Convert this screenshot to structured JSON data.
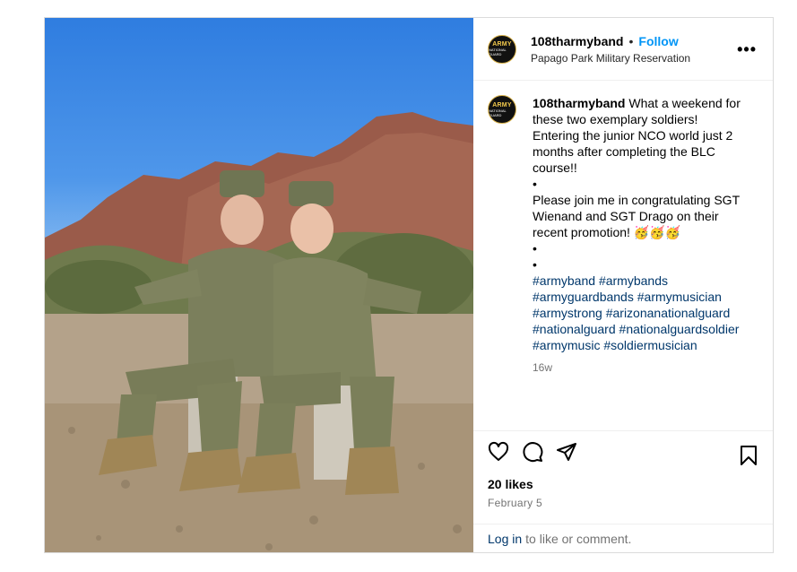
{
  "post": {
    "username": "108tharmyband",
    "separator": "•",
    "follow_label": "Follow",
    "location": "Papago Park Military Reservation",
    "more_label": "•••",
    "avatar_text_top": "ARMY",
    "avatar_text_bottom": "NATIONAL GUARD"
  },
  "caption": {
    "username": "108tharmyband",
    "text_1": "What a weekend for these two exemplary soldiers! Entering the junior NCO world just 2 months after completing the BLC course!!",
    "bullet_1": "•",
    "text_2": "Please join me in congratulating SGT Wienand and SGT Drago on their recent promotion! 🥳🥳🥳",
    "bullet_2": "•",
    "bullet_3": "•",
    "hashtags": [
      "#armyband",
      "#armybands",
      "#armyguardbands",
      "#armymusician",
      "#armystrong",
      "#arizonanationalguard",
      "#nationalguard",
      "#nationalguardsoldier",
      "#armymusic",
      "#soldiermusician"
    ],
    "time_ago": "16w"
  },
  "actions": {
    "like_icon": "heart-icon",
    "comment_icon": "comment-icon",
    "share_icon": "share-icon",
    "save_icon": "bookmark-icon",
    "likes": "20 likes",
    "date": "February 5"
  },
  "footer": {
    "login_link": "Log in",
    "login_text": "to like or comment."
  },
  "colors": {
    "link_blue": "#0095f6",
    "hashtag_blue": "#00376b",
    "muted": "#737373",
    "border": "#dbdbdb"
  }
}
